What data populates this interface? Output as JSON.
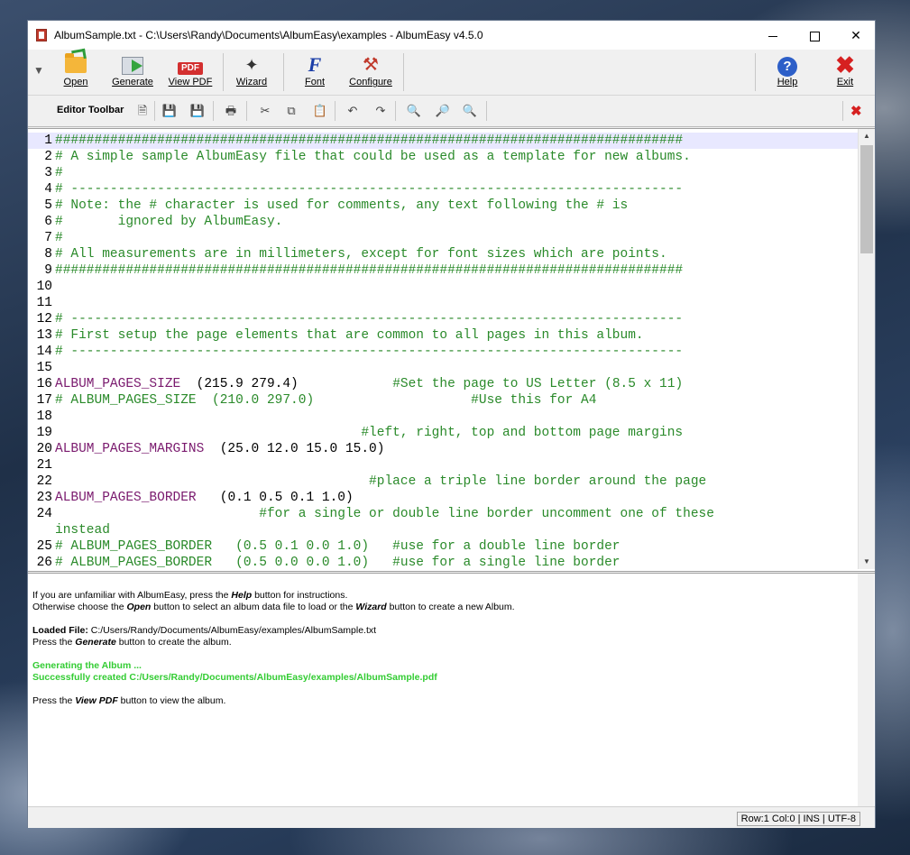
{
  "window": {
    "title": "AlbumSample.txt - C:\\Users\\Randy\\Documents\\AlbumEasy\\examples - AlbumEasy v4.5.0",
    "min_symbol": "",
    "close_symbol": "✕"
  },
  "toolbar": {
    "open": "Open",
    "generate": "Generate",
    "view_pdf": "View PDF",
    "pdf_badge": "PDF",
    "wizard": "Wizard",
    "font": "Font",
    "font_glyph": "F",
    "configure": "Configure",
    "help": "Help",
    "help_glyph": "?",
    "exit": "Exit",
    "exit_glyph": "✖"
  },
  "editor_toolbar": {
    "label": "Editor Toolbar",
    "close_glyph": "✖"
  },
  "icons": {
    "new": "new-file-icon",
    "save": "save-icon",
    "save_as": "save-as-icon",
    "print": "print-icon",
    "cut": "cut-icon",
    "copy": "copy-icon",
    "paste": "paste-icon",
    "undo": "undo-icon",
    "redo": "redo-icon",
    "find": "find-icon",
    "find_next": "find-next-icon",
    "replace": "replace-icon"
  },
  "editor": {
    "lines": [
      {
        "n": "1",
        "kw": "",
        "text": "################################################################################"
      },
      {
        "n": "2",
        "kw": "",
        "text": "# A simple sample AlbumEasy file that could be used as a template for new albums."
      },
      {
        "n": "3",
        "kw": "",
        "text": "#"
      },
      {
        "n": "4",
        "kw": "",
        "text": "# ------------------------------------------------------------------------------"
      },
      {
        "n": "5",
        "kw": "",
        "text": "# Note: the # character is used for comments, any text following the # is"
      },
      {
        "n": "6",
        "kw": "",
        "text": "#       ignored by AlbumEasy."
      },
      {
        "n": "7",
        "kw": "",
        "text": "#"
      },
      {
        "n": "8",
        "kw": "",
        "text": "# All measurements are in millimeters, except for font sizes which are points."
      },
      {
        "n": "9",
        "kw": "",
        "text": "################################################################################"
      },
      {
        "n": "10",
        "kw": "",
        "text": ""
      },
      {
        "n": "11",
        "kw": "",
        "text": ""
      },
      {
        "n": "12",
        "kw": "",
        "text": "# ------------------------------------------------------------------------------"
      },
      {
        "n": "13",
        "kw": "",
        "text": "# First setup the page elements that are common to all pages in this album."
      },
      {
        "n": "14",
        "kw": "",
        "text": "# ------------------------------------------------------------------------------"
      },
      {
        "n": "15",
        "kw": "",
        "text": ""
      },
      {
        "n": "16",
        "kw": "ALBUM_PAGES_SIZE",
        "plain": "  (215.9 279.4)            ",
        "text": "#Set the page to US Letter (8.5 x 11)"
      },
      {
        "n": "17",
        "kw": "",
        "text": "# ALBUM_PAGES_SIZE  (210.0 297.0)                    #Use this for A4"
      },
      {
        "n": "18",
        "kw": "",
        "text": ""
      },
      {
        "n": "19",
        "kw": "",
        "text": "                                       #left, right, top and bottom page margins"
      },
      {
        "n": "20",
        "kw": "ALBUM_PAGES_MARGINS",
        "plain": "  (25.0 12.0 15.0 15.0)",
        "text": ""
      },
      {
        "n": "21",
        "kw": "",
        "text": ""
      },
      {
        "n": "22",
        "kw": "",
        "text": "                                        #place a triple line border around the page"
      },
      {
        "n": "23",
        "kw": "ALBUM_PAGES_BORDER",
        "plain": "   (0.1 0.5 0.1 1.0)",
        "text": ""
      },
      {
        "n": "24",
        "kw": "",
        "text": "                          #for a single or double line border uncomment one of these"
      },
      {
        "n": "",
        "kw": "",
        "text": "instead"
      },
      {
        "n": "25",
        "kw": "",
        "text": "# ALBUM_PAGES_BORDER   (0.5 0.1 0.0 1.0)   #use for a double line border"
      },
      {
        "n": "26",
        "kw": "",
        "text": "# ALBUM_PAGES_BORDER   (0.5 0.0 0.0 1.0)   #use for a single line border"
      }
    ]
  },
  "messages": {
    "l1_a": "If you are unfamiliar with AlbumEasy, press the ",
    "l1_b": "Help",
    "l1_c": " button for instructions.",
    "l2_a": "Otherwise choose the ",
    "l2_b": "Open",
    "l2_c": " button to select an album data file to load or the ",
    "l2_d": "Wizard",
    "l2_e": " button to create a new Album.",
    "l3_a": "Loaded File:",
    "l3_b": " C:/Users/Randy/Documents/AlbumEasy/examples/AlbumSample.txt",
    "l4_a": "Press the ",
    "l4_b": "Generate",
    "l4_c": " button to create the album.",
    "l5": "Generating the Album ...",
    "l6": "Successfully created C:/Users/Randy/Documents/AlbumEasy/examples/AlbumSample.pdf",
    "l7_a": "Press the ",
    "l7_b": "View PDF",
    "l7_c": " button to view the album."
  },
  "status": {
    "text": "Row:1 Col:0 | INS | UTF-8"
  },
  "colors": {
    "comment": "#2a8a2a",
    "keyword": "#7a1a6e",
    "success": "#33cc33",
    "current_line": "#e8e8ff"
  }
}
